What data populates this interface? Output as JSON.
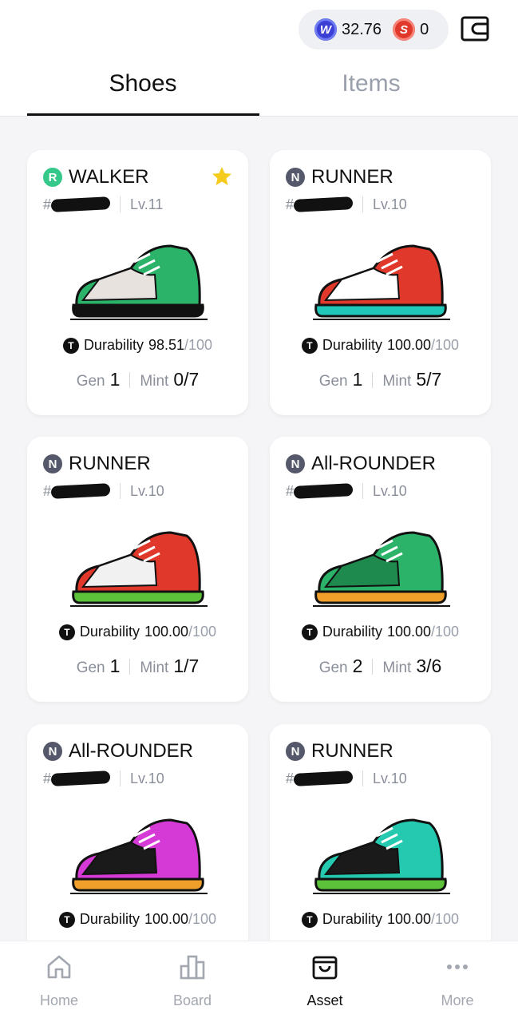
{
  "header": {
    "balance_w": "32.76",
    "balance_s": "0",
    "coin_w_glyph": "W",
    "coin_s_glyph": "S",
    "wallet_icon": "wallet-icon"
  },
  "tabs": [
    {
      "label": "Shoes",
      "active": true
    },
    {
      "label": "Items",
      "active": false
    }
  ],
  "shoes": [
    {
      "rarity": "R",
      "type": "WALKER",
      "favorite": true,
      "level": "Lv.11",
      "id_prefix": "#",
      "durability_label": "Durability",
      "durability": "98.51",
      "durability_max": "/100",
      "gen_label": "Gen",
      "gen": "1",
      "mint_label": "Mint",
      "mint": "0/7",
      "colors": [
        "#2bb36a",
        "#e8e2df",
        "#111111"
      ]
    },
    {
      "rarity": "N",
      "type": "RUNNER",
      "favorite": false,
      "level": "Lv.10",
      "id_prefix": "#",
      "durability_label": "Durability",
      "durability": "100.00",
      "durability_max": "/100",
      "gen_label": "Gen",
      "gen": "1",
      "mint_label": "Mint",
      "mint": "5/7",
      "colors": [
        "#e0392b",
        "#ffffff",
        "#1fc8b8"
      ]
    },
    {
      "rarity": "N",
      "type": "RUNNER",
      "favorite": false,
      "level": "Lv.10",
      "id_prefix": "#",
      "durability_label": "Durability",
      "durability": "100.00",
      "durability_max": "/100",
      "gen_label": "Gen",
      "gen": "1",
      "mint_label": "Mint",
      "mint": "1/7",
      "colors": [
        "#e0392b",
        "#f1f1f1",
        "#5cc23a"
      ]
    },
    {
      "rarity": "N",
      "type": "All-ROUNDER",
      "favorite": false,
      "level": "Lv.10",
      "id_prefix": "#",
      "durability_label": "Durability",
      "durability": "100.00",
      "durability_max": "/100",
      "gen_label": "Gen",
      "gen": "2",
      "mint_label": "Mint",
      "mint": "3/6",
      "colors": [
        "#2bb36a",
        "#1f8a4e",
        "#f0a02a"
      ]
    },
    {
      "rarity": "N",
      "type": "All-ROUNDER",
      "favorite": false,
      "level": "Lv.10",
      "id_prefix": "#",
      "durability_label": "Durability",
      "durability": "100.00",
      "durability_max": "/100",
      "gen_label": "Gen",
      "gen": "",
      "mint_label": "Mint",
      "mint": "",
      "colors": [
        "#d63ad6",
        "#1a1a1a",
        "#f0a02a"
      ]
    },
    {
      "rarity": "N",
      "type": "RUNNER",
      "favorite": false,
      "level": "Lv.10",
      "id_prefix": "#",
      "durability_label": "Durability",
      "durability": "100.00",
      "durability_max": "/100",
      "gen_label": "Gen",
      "gen": "",
      "mint_label": "Mint",
      "mint": "",
      "colors": [
        "#25c9b0",
        "#1a1a1a",
        "#5cc23a"
      ]
    }
  ],
  "nav": [
    {
      "label": "Home",
      "icon": "home-icon",
      "active": false
    },
    {
      "label": "Board",
      "icon": "bar-chart-icon",
      "active": false
    },
    {
      "label": "Asset",
      "icon": "bag-icon",
      "active": true
    },
    {
      "label": "More",
      "icon": "more-dots-icon",
      "active": false
    }
  ]
}
